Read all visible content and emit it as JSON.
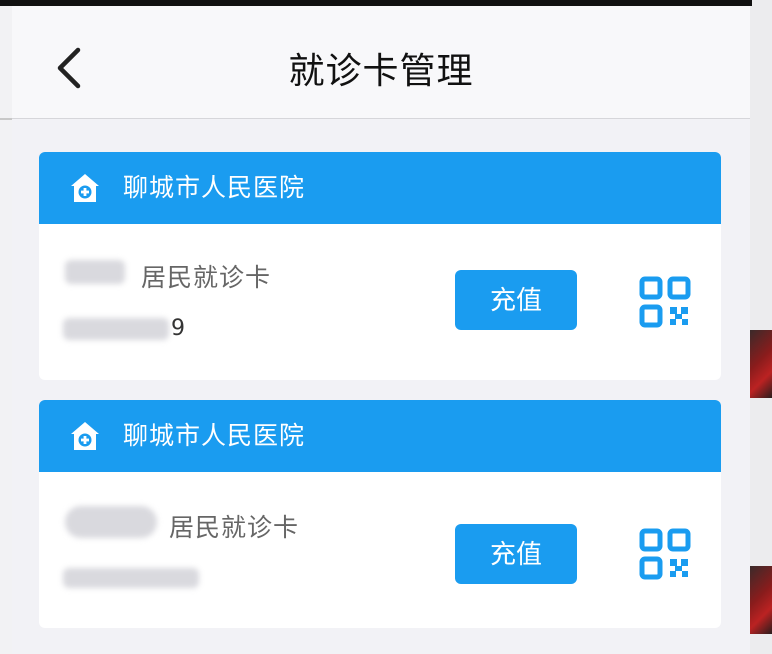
{
  "nav": {
    "title": "就诊卡管理",
    "back_icon": "chevron-left-icon"
  },
  "cards": [
    {
      "hospital": "聊城市人民医院",
      "card_type": "居民就诊卡",
      "card_number_suffix": "9",
      "recharge_label": "充值",
      "icon": "hospital-icon",
      "qr_icon": "qr-code-icon"
    },
    {
      "hospital": "聊城市人民医院",
      "card_type": "居民就诊卡",
      "card_number_suffix": "",
      "recharge_label": "充值",
      "icon": "hospital-icon",
      "qr_icon": "qr-code-icon"
    }
  ],
  "colors": {
    "accent": "#1a9cf0",
    "background": "#f2f2f6",
    "card": "#ffffff"
  }
}
